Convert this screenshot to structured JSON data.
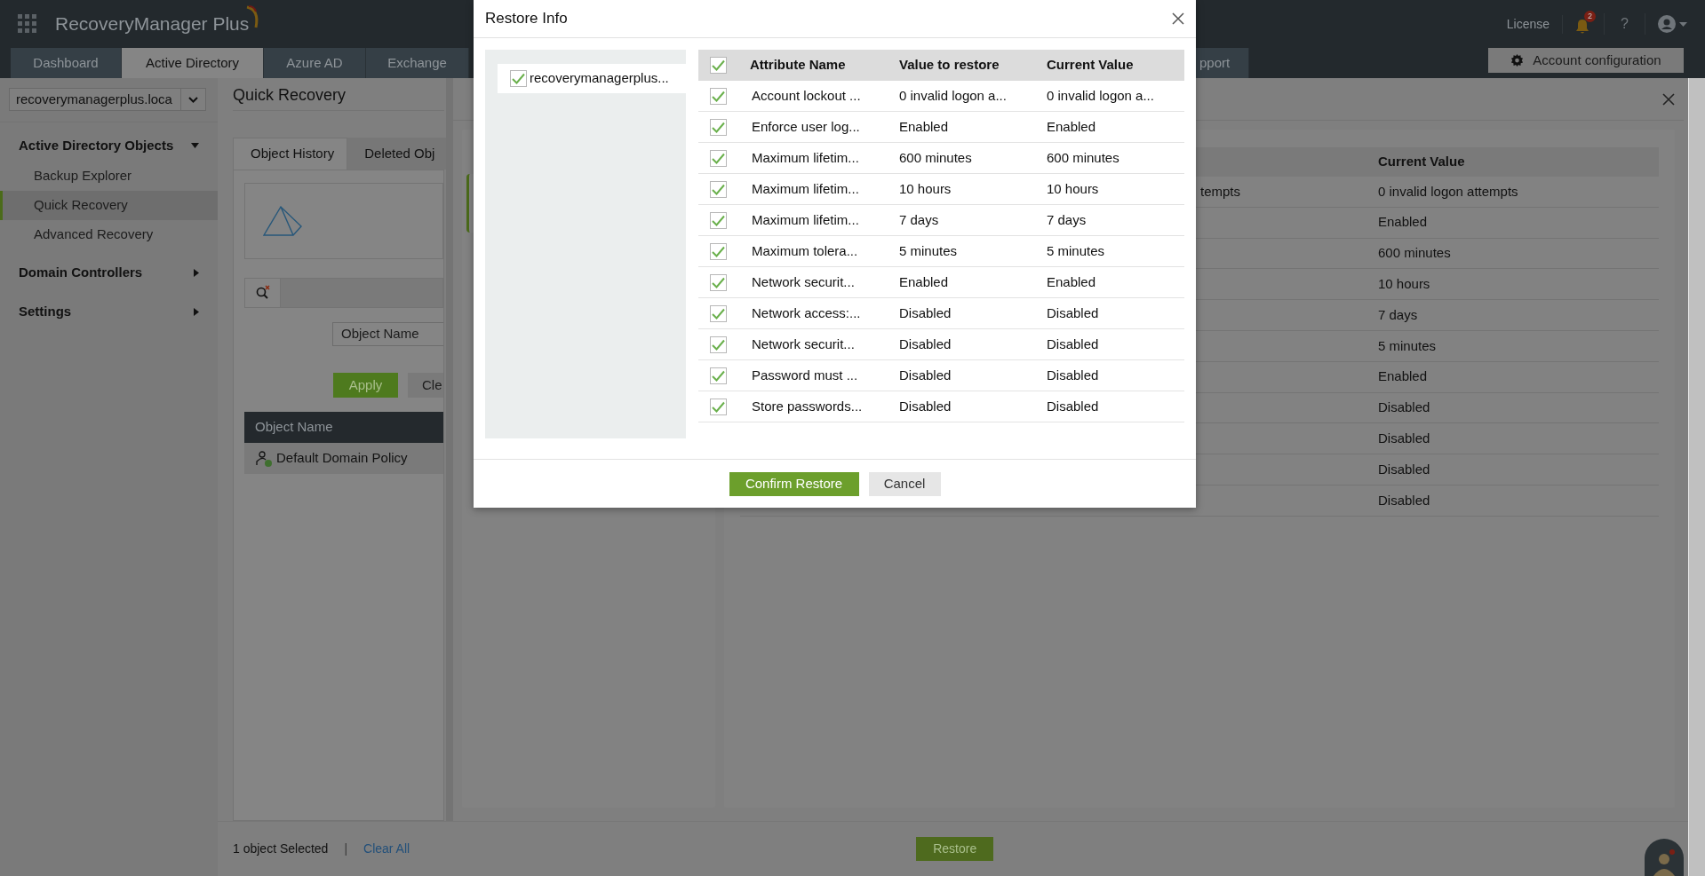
{
  "app": {
    "name": "RecoveryManager Plus"
  },
  "header": {
    "license": "License",
    "notifications": "2",
    "help": "?"
  },
  "tabs": [
    {
      "label": "Dashboard",
      "selected": false
    },
    {
      "label": "Active Directory",
      "selected": true
    },
    {
      "label": "Azure AD",
      "selected": false
    },
    {
      "label": "Exchange",
      "selected": false
    },
    {
      "label": "pport",
      "selected": false
    }
  ],
  "account_button": "Account configuration",
  "domain_select": "recoverymanagerplus.loca",
  "sidebar": [
    {
      "label": "Active Directory Objects",
      "expanded": true,
      "children": [
        {
          "label": "Backup Explorer",
          "selected": false
        },
        {
          "label": "Quick Recovery",
          "selected": true
        },
        {
          "label": "Advanced Recovery",
          "selected": false
        }
      ]
    },
    {
      "label": "Domain Controllers",
      "expanded": false
    },
    {
      "label": "Settings",
      "expanded": false
    }
  ],
  "page": {
    "title": "Quick Recovery",
    "tabs": [
      {
        "label": "Object History",
        "selected": true
      },
      {
        "label": "Deleted Obj",
        "selected": false
      }
    ],
    "filter_placeholder": "Object Name",
    "apply": "Apply",
    "clear": "Cle",
    "table": {
      "column": "Object Name",
      "rows": [
        "Default Domain Policy"
      ]
    }
  },
  "panel": {
    "cut_text": "tempts",
    "column": "Current Value",
    "values": [
      "0 invalid logon attempts",
      "Enabled",
      "600 minutes",
      "10 hours",
      "7 days",
      "5 minutes",
      "Enabled",
      "Disabled",
      "Disabled",
      "Disabled",
      "Disabled"
    ]
  },
  "bottom": {
    "selected_count": "1 object Selected",
    "separator": "|",
    "clear_all": "Clear All",
    "restore": "Restore"
  },
  "modal": {
    "title": "Restore Info",
    "objects": [
      {
        "label": "recoverymanagerplus...",
        "checked": true
      }
    ],
    "all_checked": true,
    "columns": [
      "Attribute Name",
      "Value to restore",
      "Current Value"
    ],
    "rows": [
      {
        "checked": true,
        "attribute": "Account lockout ...",
        "restore": "0 invalid logon a...",
        "current": "0 invalid logon a..."
      },
      {
        "checked": true,
        "attribute": "Enforce user log...",
        "restore": "Enabled",
        "current": "Enabled"
      },
      {
        "checked": true,
        "attribute": "Maximum lifetim...",
        "restore": "600 minutes",
        "current": "600 minutes"
      },
      {
        "checked": true,
        "attribute": "Maximum lifetim...",
        "restore": "10 hours",
        "current": "10 hours"
      },
      {
        "checked": true,
        "attribute": "Maximum lifetim...",
        "restore": "7 days",
        "current": "7 days"
      },
      {
        "checked": true,
        "attribute": "Maximum tolera...",
        "restore": "5 minutes",
        "current": "5 minutes"
      },
      {
        "checked": true,
        "attribute": "Network securit...",
        "restore": "Enabled",
        "current": "Enabled"
      },
      {
        "checked": true,
        "attribute": "Network access:...",
        "restore": "Disabled",
        "current": "Disabled"
      },
      {
        "checked": true,
        "attribute": "Network securit...",
        "restore": "Disabled",
        "current": "Disabled"
      },
      {
        "checked": true,
        "attribute": "Password must ...",
        "restore": "Disabled",
        "current": "Disabled"
      },
      {
        "checked": true,
        "attribute": "Store passwords...",
        "restore": "Disabled",
        "current": "Disabled"
      }
    ],
    "confirm": "Confirm Restore",
    "cancel": "Cancel"
  }
}
